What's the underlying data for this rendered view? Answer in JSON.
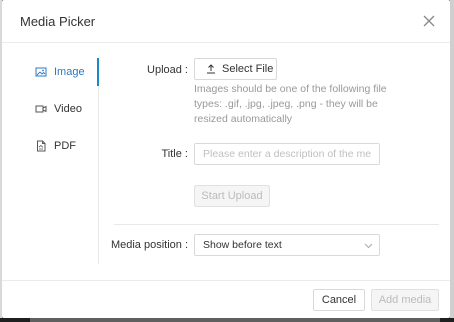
{
  "dialog": {
    "title": "Media Picker"
  },
  "sidebar": {
    "items": [
      {
        "label": "Image",
        "icon": "image-icon",
        "active": true
      },
      {
        "label": "Video",
        "icon": "video-icon",
        "active": false
      },
      {
        "label": "PDF",
        "icon": "pdf-icon",
        "active": false
      }
    ]
  },
  "form": {
    "upload_label": "Upload :",
    "select_file_label": "Select File",
    "help_text": "Images should be one of the following file types: .gif, .jpg, .jpeg, .png - they will be resized automatically",
    "title_label": "Title :",
    "title_placeholder": "Please enter a description of the media",
    "title_value": "",
    "start_upload_label": "Start Upload",
    "media_position_label": "Media position :",
    "media_position_value": "Show before text"
  },
  "footer": {
    "cancel_label": "Cancel",
    "add_media_label": "Add media"
  },
  "colors": {
    "accent": "#1e88c7",
    "active_text": "#2b78c5",
    "disabled_bg": "#f5f5f5"
  }
}
